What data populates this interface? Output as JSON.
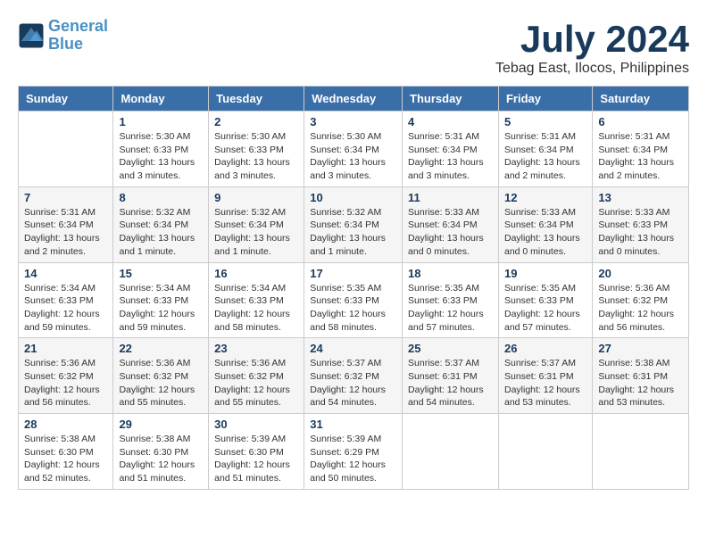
{
  "header": {
    "logo_line1": "General",
    "logo_line2": "Blue",
    "month": "July 2024",
    "location": "Tebag East, Ilocos, Philippines"
  },
  "columns": [
    "Sunday",
    "Monday",
    "Tuesday",
    "Wednesday",
    "Thursday",
    "Friday",
    "Saturday"
  ],
  "weeks": [
    [
      {
        "day": "",
        "info": ""
      },
      {
        "day": "1",
        "info": "Sunrise: 5:30 AM\nSunset: 6:33 PM\nDaylight: 13 hours\nand 3 minutes."
      },
      {
        "day": "2",
        "info": "Sunrise: 5:30 AM\nSunset: 6:33 PM\nDaylight: 13 hours\nand 3 minutes."
      },
      {
        "day": "3",
        "info": "Sunrise: 5:30 AM\nSunset: 6:34 PM\nDaylight: 13 hours\nand 3 minutes."
      },
      {
        "day": "4",
        "info": "Sunrise: 5:31 AM\nSunset: 6:34 PM\nDaylight: 13 hours\nand 3 minutes."
      },
      {
        "day": "5",
        "info": "Sunrise: 5:31 AM\nSunset: 6:34 PM\nDaylight: 13 hours\nand 2 minutes."
      },
      {
        "day": "6",
        "info": "Sunrise: 5:31 AM\nSunset: 6:34 PM\nDaylight: 13 hours\nand 2 minutes."
      }
    ],
    [
      {
        "day": "7",
        "info": "Sunrise: 5:31 AM\nSunset: 6:34 PM\nDaylight: 13 hours\nand 2 minutes."
      },
      {
        "day": "8",
        "info": "Sunrise: 5:32 AM\nSunset: 6:34 PM\nDaylight: 13 hours\nand 1 minute."
      },
      {
        "day": "9",
        "info": "Sunrise: 5:32 AM\nSunset: 6:34 PM\nDaylight: 13 hours\nand 1 minute."
      },
      {
        "day": "10",
        "info": "Sunrise: 5:32 AM\nSunset: 6:34 PM\nDaylight: 13 hours\nand 1 minute."
      },
      {
        "day": "11",
        "info": "Sunrise: 5:33 AM\nSunset: 6:34 PM\nDaylight: 13 hours\nand 0 minutes."
      },
      {
        "day": "12",
        "info": "Sunrise: 5:33 AM\nSunset: 6:34 PM\nDaylight: 13 hours\nand 0 minutes."
      },
      {
        "day": "13",
        "info": "Sunrise: 5:33 AM\nSunset: 6:33 PM\nDaylight: 13 hours\nand 0 minutes."
      }
    ],
    [
      {
        "day": "14",
        "info": "Sunrise: 5:34 AM\nSunset: 6:33 PM\nDaylight: 12 hours\nand 59 minutes."
      },
      {
        "day": "15",
        "info": "Sunrise: 5:34 AM\nSunset: 6:33 PM\nDaylight: 12 hours\nand 59 minutes."
      },
      {
        "day": "16",
        "info": "Sunrise: 5:34 AM\nSunset: 6:33 PM\nDaylight: 12 hours\nand 58 minutes."
      },
      {
        "day": "17",
        "info": "Sunrise: 5:35 AM\nSunset: 6:33 PM\nDaylight: 12 hours\nand 58 minutes."
      },
      {
        "day": "18",
        "info": "Sunrise: 5:35 AM\nSunset: 6:33 PM\nDaylight: 12 hours\nand 57 minutes."
      },
      {
        "day": "19",
        "info": "Sunrise: 5:35 AM\nSunset: 6:33 PM\nDaylight: 12 hours\nand 57 minutes."
      },
      {
        "day": "20",
        "info": "Sunrise: 5:36 AM\nSunset: 6:32 PM\nDaylight: 12 hours\nand 56 minutes."
      }
    ],
    [
      {
        "day": "21",
        "info": "Sunrise: 5:36 AM\nSunset: 6:32 PM\nDaylight: 12 hours\nand 56 minutes."
      },
      {
        "day": "22",
        "info": "Sunrise: 5:36 AM\nSunset: 6:32 PM\nDaylight: 12 hours\nand 55 minutes."
      },
      {
        "day": "23",
        "info": "Sunrise: 5:36 AM\nSunset: 6:32 PM\nDaylight: 12 hours\nand 55 minutes."
      },
      {
        "day": "24",
        "info": "Sunrise: 5:37 AM\nSunset: 6:32 PM\nDaylight: 12 hours\nand 54 minutes."
      },
      {
        "day": "25",
        "info": "Sunrise: 5:37 AM\nSunset: 6:31 PM\nDaylight: 12 hours\nand 54 minutes."
      },
      {
        "day": "26",
        "info": "Sunrise: 5:37 AM\nSunset: 6:31 PM\nDaylight: 12 hours\nand 53 minutes."
      },
      {
        "day": "27",
        "info": "Sunrise: 5:38 AM\nSunset: 6:31 PM\nDaylight: 12 hours\nand 53 minutes."
      }
    ],
    [
      {
        "day": "28",
        "info": "Sunrise: 5:38 AM\nSunset: 6:30 PM\nDaylight: 12 hours\nand 52 minutes."
      },
      {
        "day": "29",
        "info": "Sunrise: 5:38 AM\nSunset: 6:30 PM\nDaylight: 12 hours\nand 51 minutes."
      },
      {
        "day": "30",
        "info": "Sunrise: 5:39 AM\nSunset: 6:30 PM\nDaylight: 12 hours\nand 51 minutes."
      },
      {
        "day": "31",
        "info": "Sunrise: 5:39 AM\nSunset: 6:29 PM\nDaylight: 12 hours\nand 50 minutes."
      },
      {
        "day": "",
        "info": ""
      },
      {
        "day": "",
        "info": ""
      },
      {
        "day": "",
        "info": ""
      }
    ]
  ]
}
